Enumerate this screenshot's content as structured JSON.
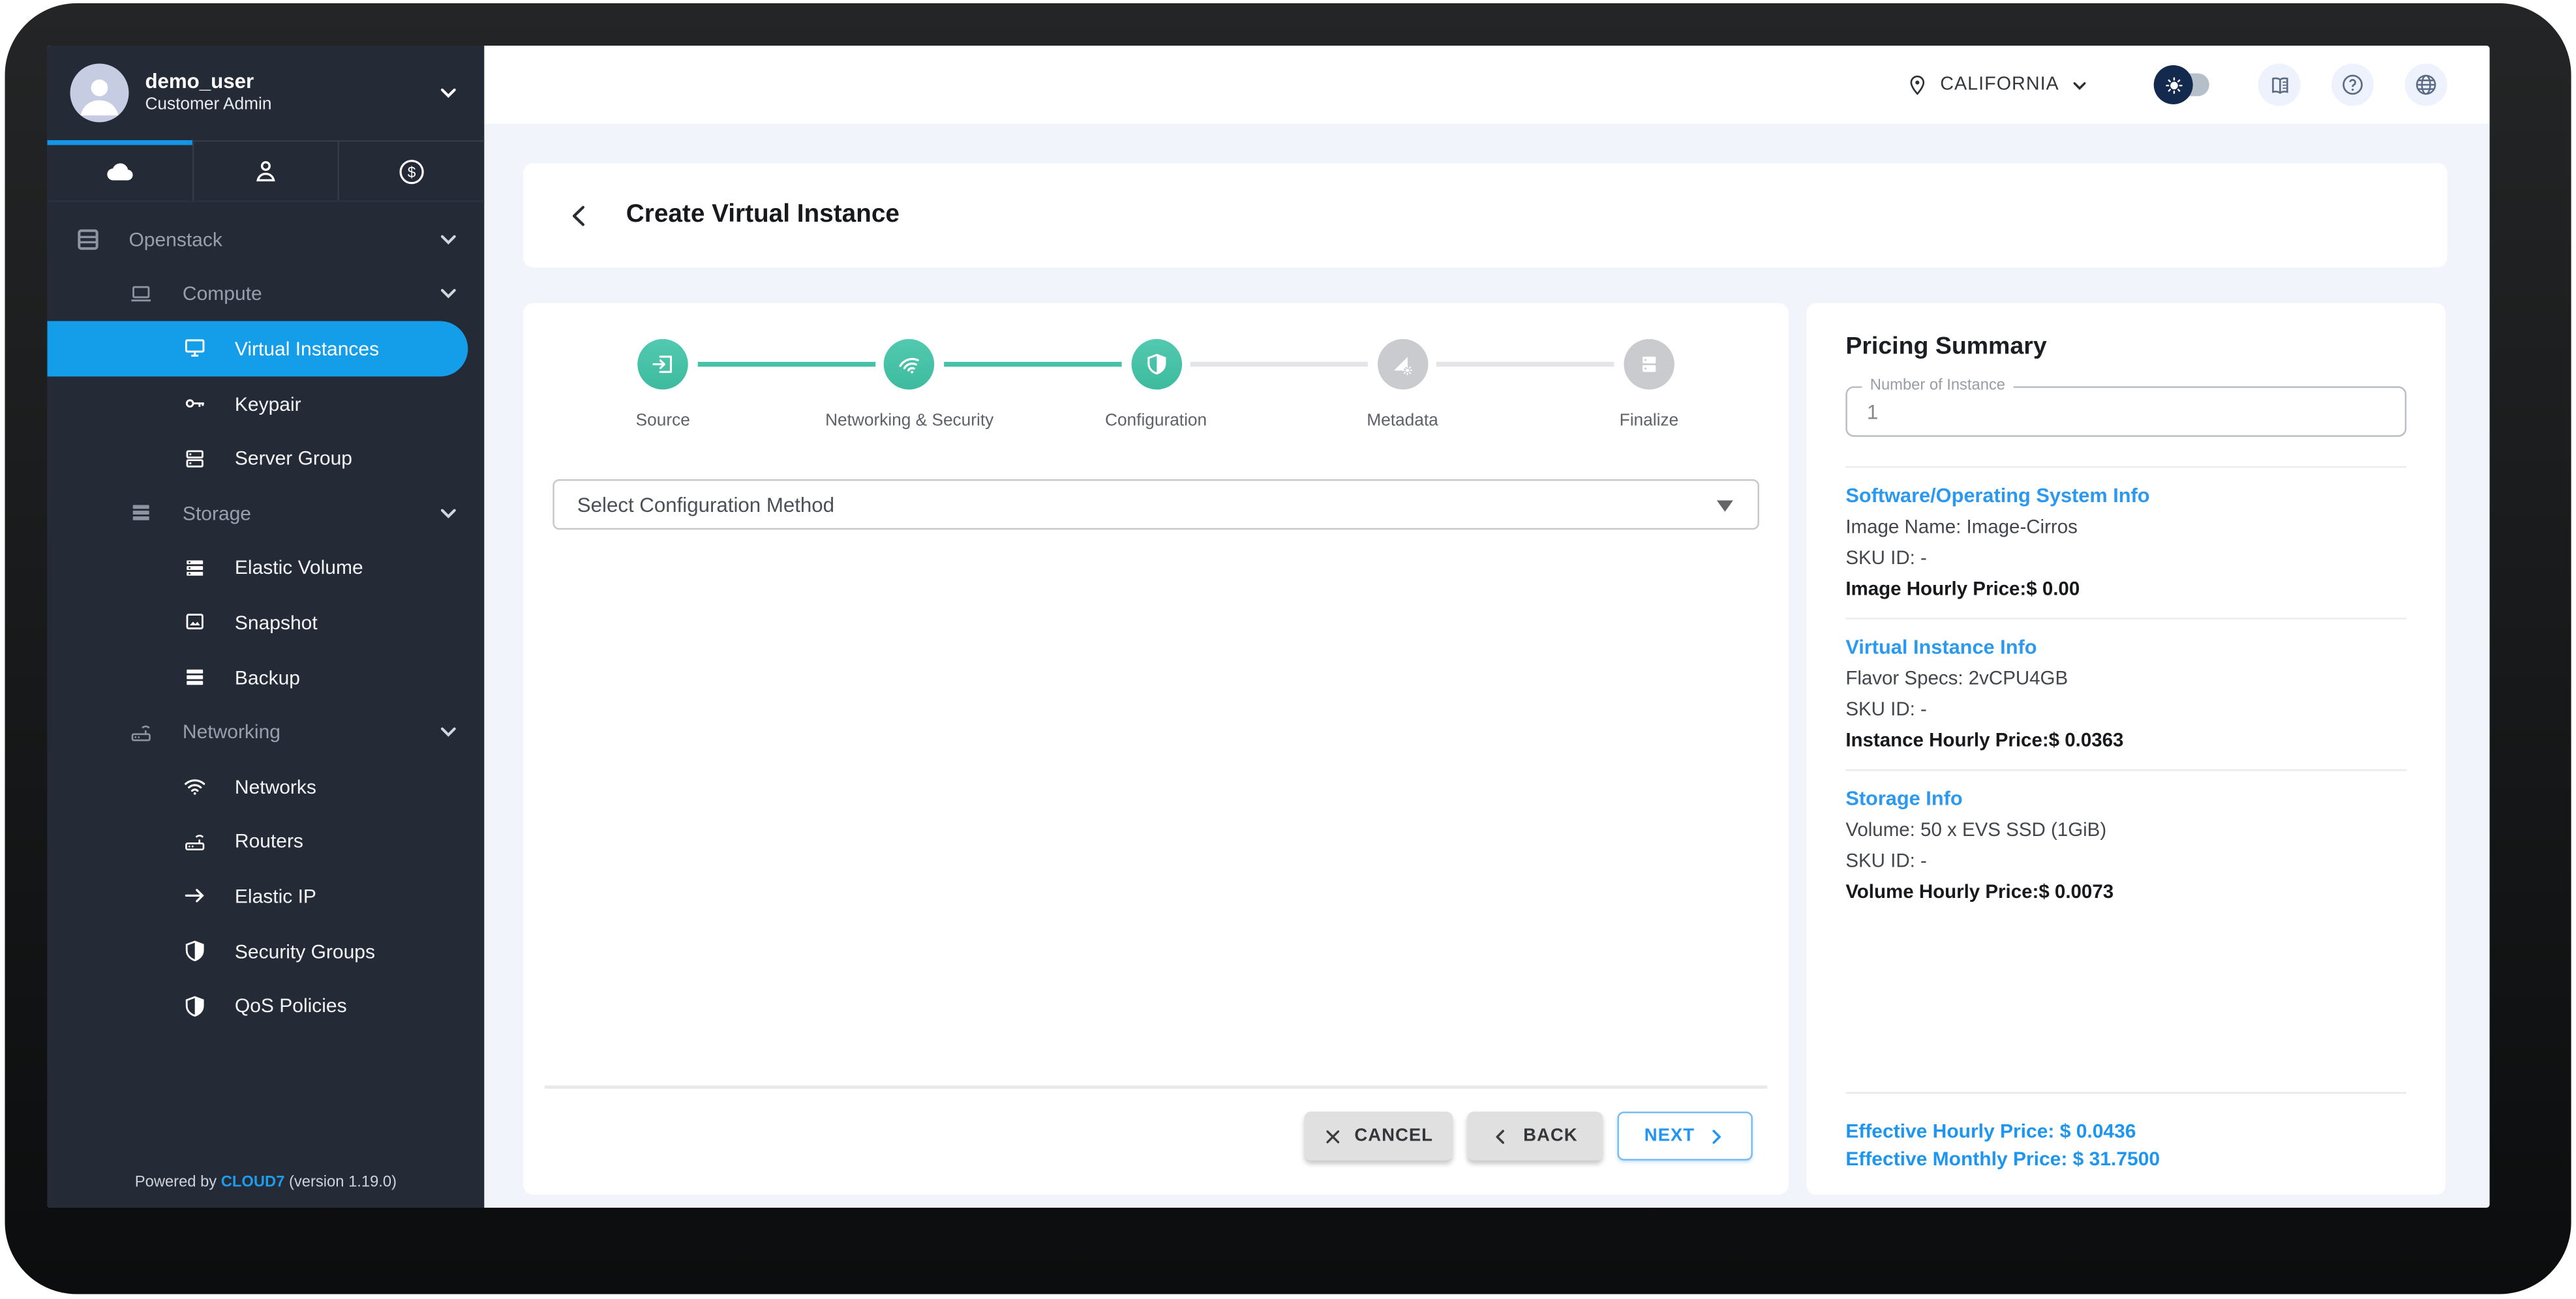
{
  "colors": {
    "sidebar_bg": "#252a37",
    "active_nav_blue": "#149eea",
    "accent_blue": "#2196f3",
    "step_teal": "#46c1a7",
    "step_gray": "#c9cbce",
    "content_bg": "#f1f4fa",
    "toggle_knob_navy": "#13294e",
    "link_blue": "#1e9be9"
  },
  "sidebar": {
    "user": {
      "name": "demo_user",
      "role": "Customer Admin"
    },
    "tabs": [
      {
        "icon": "cloud-icon",
        "active": true
      },
      {
        "icon": "person-icon",
        "active": false
      },
      {
        "icon": "dollar-icon",
        "active": false
      }
    ],
    "nav": [
      {
        "label": "Openstack",
        "level": 1,
        "group": true
      },
      {
        "label": "Compute",
        "level": 2,
        "group": true
      },
      {
        "label": "Virtual Instances",
        "level": 3,
        "active": true
      },
      {
        "label": "Keypair",
        "level": 3
      },
      {
        "label": "Server Group",
        "level": 3
      },
      {
        "label": "Storage",
        "level": 2,
        "group": true
      },
      {
        "label": "Elastic Volume",
        "level": 3
      },
      {
        "label": "Snapshot",
        "level": 3
      },
      {
        "label": "Backup",
        "level": 3
      },
      {
        "label": "Networking",
        "level": 2,
        "group": true
      },
      {
        "label": "Networks",
        "level": 3
      },
      {
        "label": "Routers",
        "level": 3
      },
      {
        "label": "Elastic IP",
        "level": 3
      },
      {
        "label": "Security Groups",
        "level": 3
      },
      {
        "label": "QoS Policies",
        "level": 3
      }
    ],
    "footer": {
      "prefix": "Powered by",
      "brand": "CLOUD7",
      "suffix": "(version 1.19.0)"
    }
  },
  "topbar": {
    "region": "CALIFORNIA"
  },
  "page": {
    "title": "Create Virtual Instance"
  },
  "stepper": {
    "steps": [
      {
        "label": "Source",
        "state": "done",
        "icon": "login-icon"
      },
      {
        "label": "Networking & Security",
        "state": "done",
        "icon": "wifi-icon"
      },
      {
        "label": "Configuration",
        "state": "active",
        "icon": "shield-icon"
      },
      {
        "label": "Metadata",
        "state": "todo",
        "icon": "metadata-gear-icon"
      },
      {
        "label": "Finalize",
        "state": "todo",
        "icon": "server-icon"
      }
    ]
  },
  "form": {
    "config_method_placeholder": "Select Configuration Method"
  },
  "actions": {
    "cancel": "CANCEL",
    "back": "BACK",
    "next": "NEXT"
  },
  "pricing": {
    "title": "Pricing Summary",
    "instance_count_label": "Number of Instance",
    "instance_count_value": "1",
    "sections": [
      {
        "heading": "Software/Operating System Info",
        "rows": [
          {
            "text": "Image Name: Image-Cirros",
            "bold": false
          },
          {
            "text": "SKU ID: -",
            "bold": false
          },
          {
            "text": "Image Hourly Price:$ 0.00",
            "bold": true
          }
        ]
      },
      {
        "heading": "Virtual Instance Info",
        "rows": [
          {
            "text": "Flavor Specs: 2vCPU4GB",
            "bold": false
          },
          {
            "text": "SKU ID: -",
            "bold": false
          },
          {
            "text": "Instance Hourly Price:$ 0.0363",
            "bold": true
          }
        ]
      },
      {
        "heading": "Storage Info",
        "rows": [
          {
            "text": "Volume: 50 x EVS SSD (1GiB)",
            "bold": false
          },
          {
            "text": "SKU ID: -",
            "bold": false
          },
          {
            "text": "Volume Hourly Price:$ 0.0073",
            "bold": true
          }
        ]
      }
    ],
    "effective_hourly": "Effective Hourly Price: $ 0.0436",
    "effective_monthly": "Effective Monthly Price: $ 31.7500"
  }
}
